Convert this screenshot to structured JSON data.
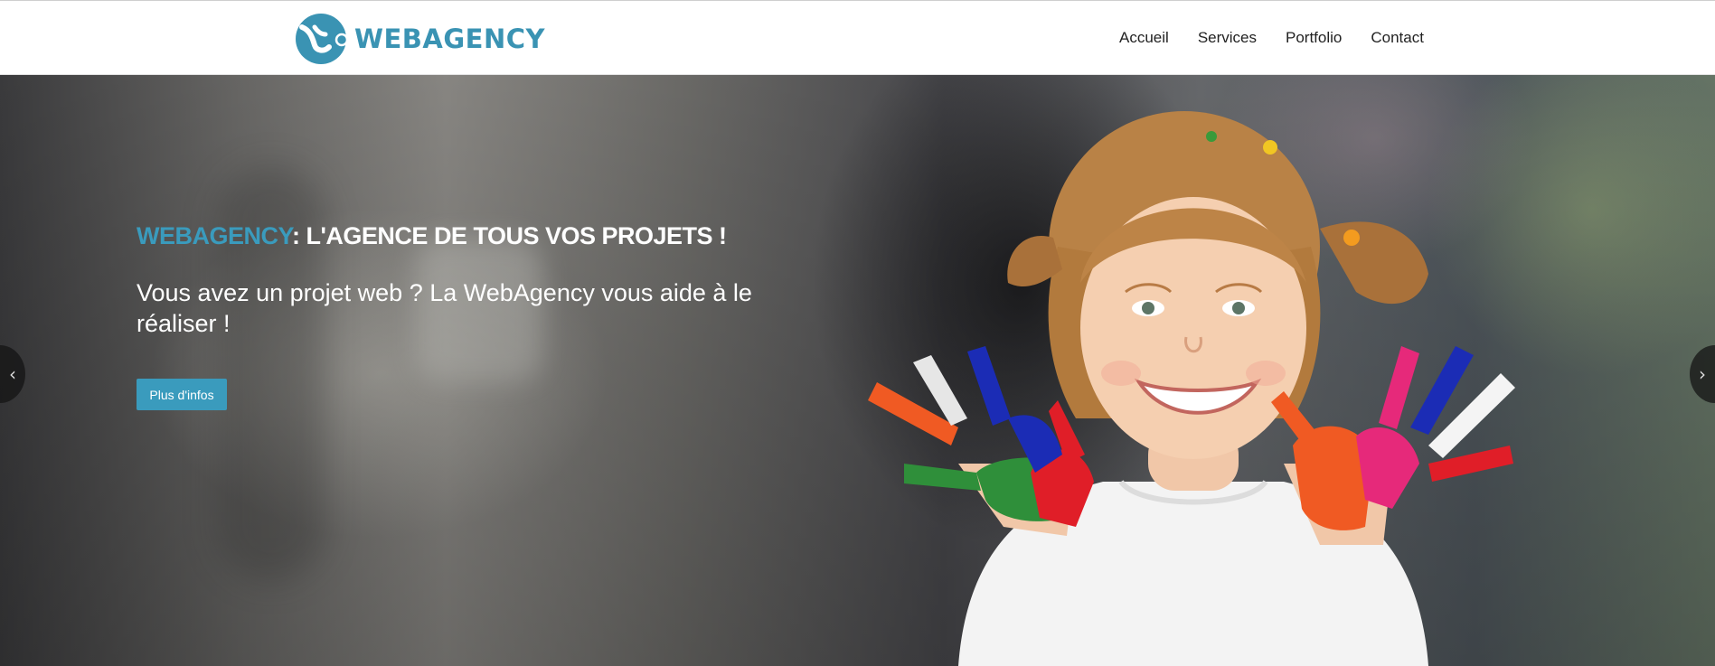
{
  "header": {
    "logo_text": "WEBAGENCY",
    "nav": [
      "Accueil",
      "Services",
      "Portfolio",
      "Contact"
    ]
  },
  "hero": {
    "title_brand": "WEBAGENCY",
    "title_rest": ": L'AGENCE DE TOUS VOS PROJETS !",
    "subtitle": "Vous avez un projet web ? La WebAgency vous aide à le réaliser !",
    "cta_label": "Plus d'infos",
    "prev_icon": "chevron-left-icon",
    "next_icon": "chevron-right-icon",
    "prev_glyph": "‹",
    "next_glyph": "›"
  },
  "colors": {
    "accent": "#3a9bbd",
    "logo": "#3a93b3"
  }
}
